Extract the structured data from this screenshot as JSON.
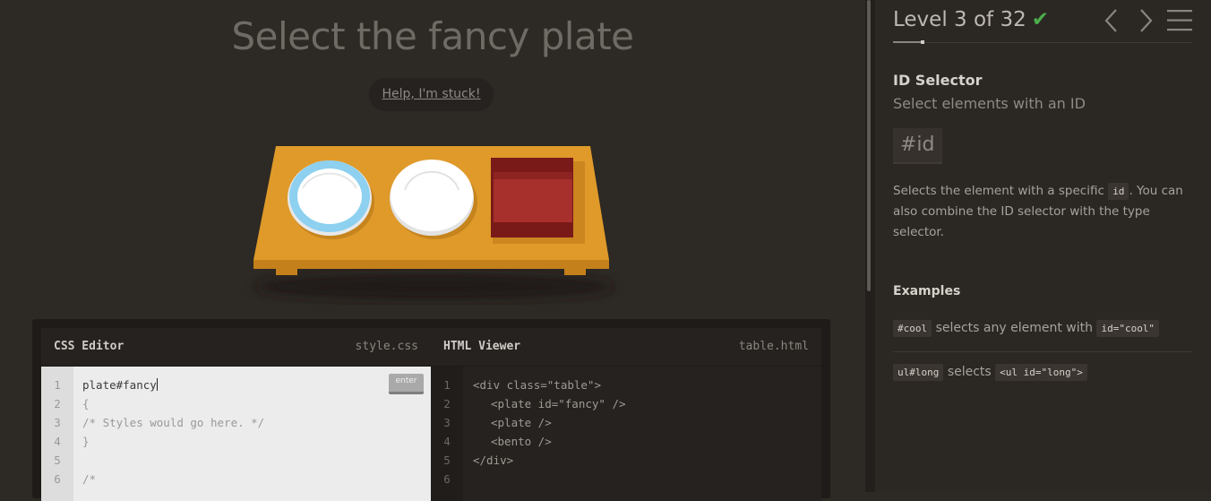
{
  "game": {
    "title": "Select the fancy plate",
    "help_link": "Help, I'm stuck!"
  },
  "css_editor": {
    "title": "CSS Editor",
    "filename": "style.css",
    "enter_label": "enter",
    "lines": [
      {
        "n": "1",
        "text": "plate#fancy"
      },
      {
        "n": "2",
        "text": "{"
      },
      {
        "n": "3",
        "text": "/* Styles would go here. */"
      },
      {
        "n": "4",
        "text": "}"
      },
      {
        "n": "5",
        "text": ""
      },
      {
        "n": "6",
        "text": "/*"
      }
    ]
  },
  "html_viewer": {
    "title": "HTML Viewer",
    "filename": "table.html",
    "lines": [
      {
        "n": "1",
        "text": "<div class=\"table\">"
      },
      {
        "n": "2",
        "text": "<plate id=\"fancy\" />"
      },
      {
        "n": "3",
        "text": "<plate />"
      },
      {
        "n": "4",
        "text": "<bento />"
      },
      {
        "n": "5",
        "text": "</div>"
      },
      {
        "n": "6",
        "text": ""
      }
    ]
  },
  "sidebar": {
    "level_text": "Level 3 of 32",
    "check": "✔",
    "selector_name": "ID Selector",
    "selector_title": "Select elements with an ID",
    "syntax": "#id",
    "hint_before": "Selects the element with a specific ",
    "hint_tag": "id",
    "hint_after": ". You can also combine the ID selector with the type selector.",
    "examples_title": "Examples",
    "examples": [
      {
        "code": "#cool",
        "text": "selects any element with",
        "code2": "id=\"cool\""
      },
      {
        "code": "ul#long",
        "text": "selects",
        "code2": "<ul id=\"long\">"
      }
    ]
  },
  "colors": {
    "background": "#2d2924",
    "table": "#df9a2a",
    "plate_fancy_ring": "#8fd0f0",
    "bento": "#a52a2a",
    "check_green": "#4cae4c"
  },
  "icons": [
    "prev-icon",
    "next-icon",
    "menu-icon"
  ]
}
